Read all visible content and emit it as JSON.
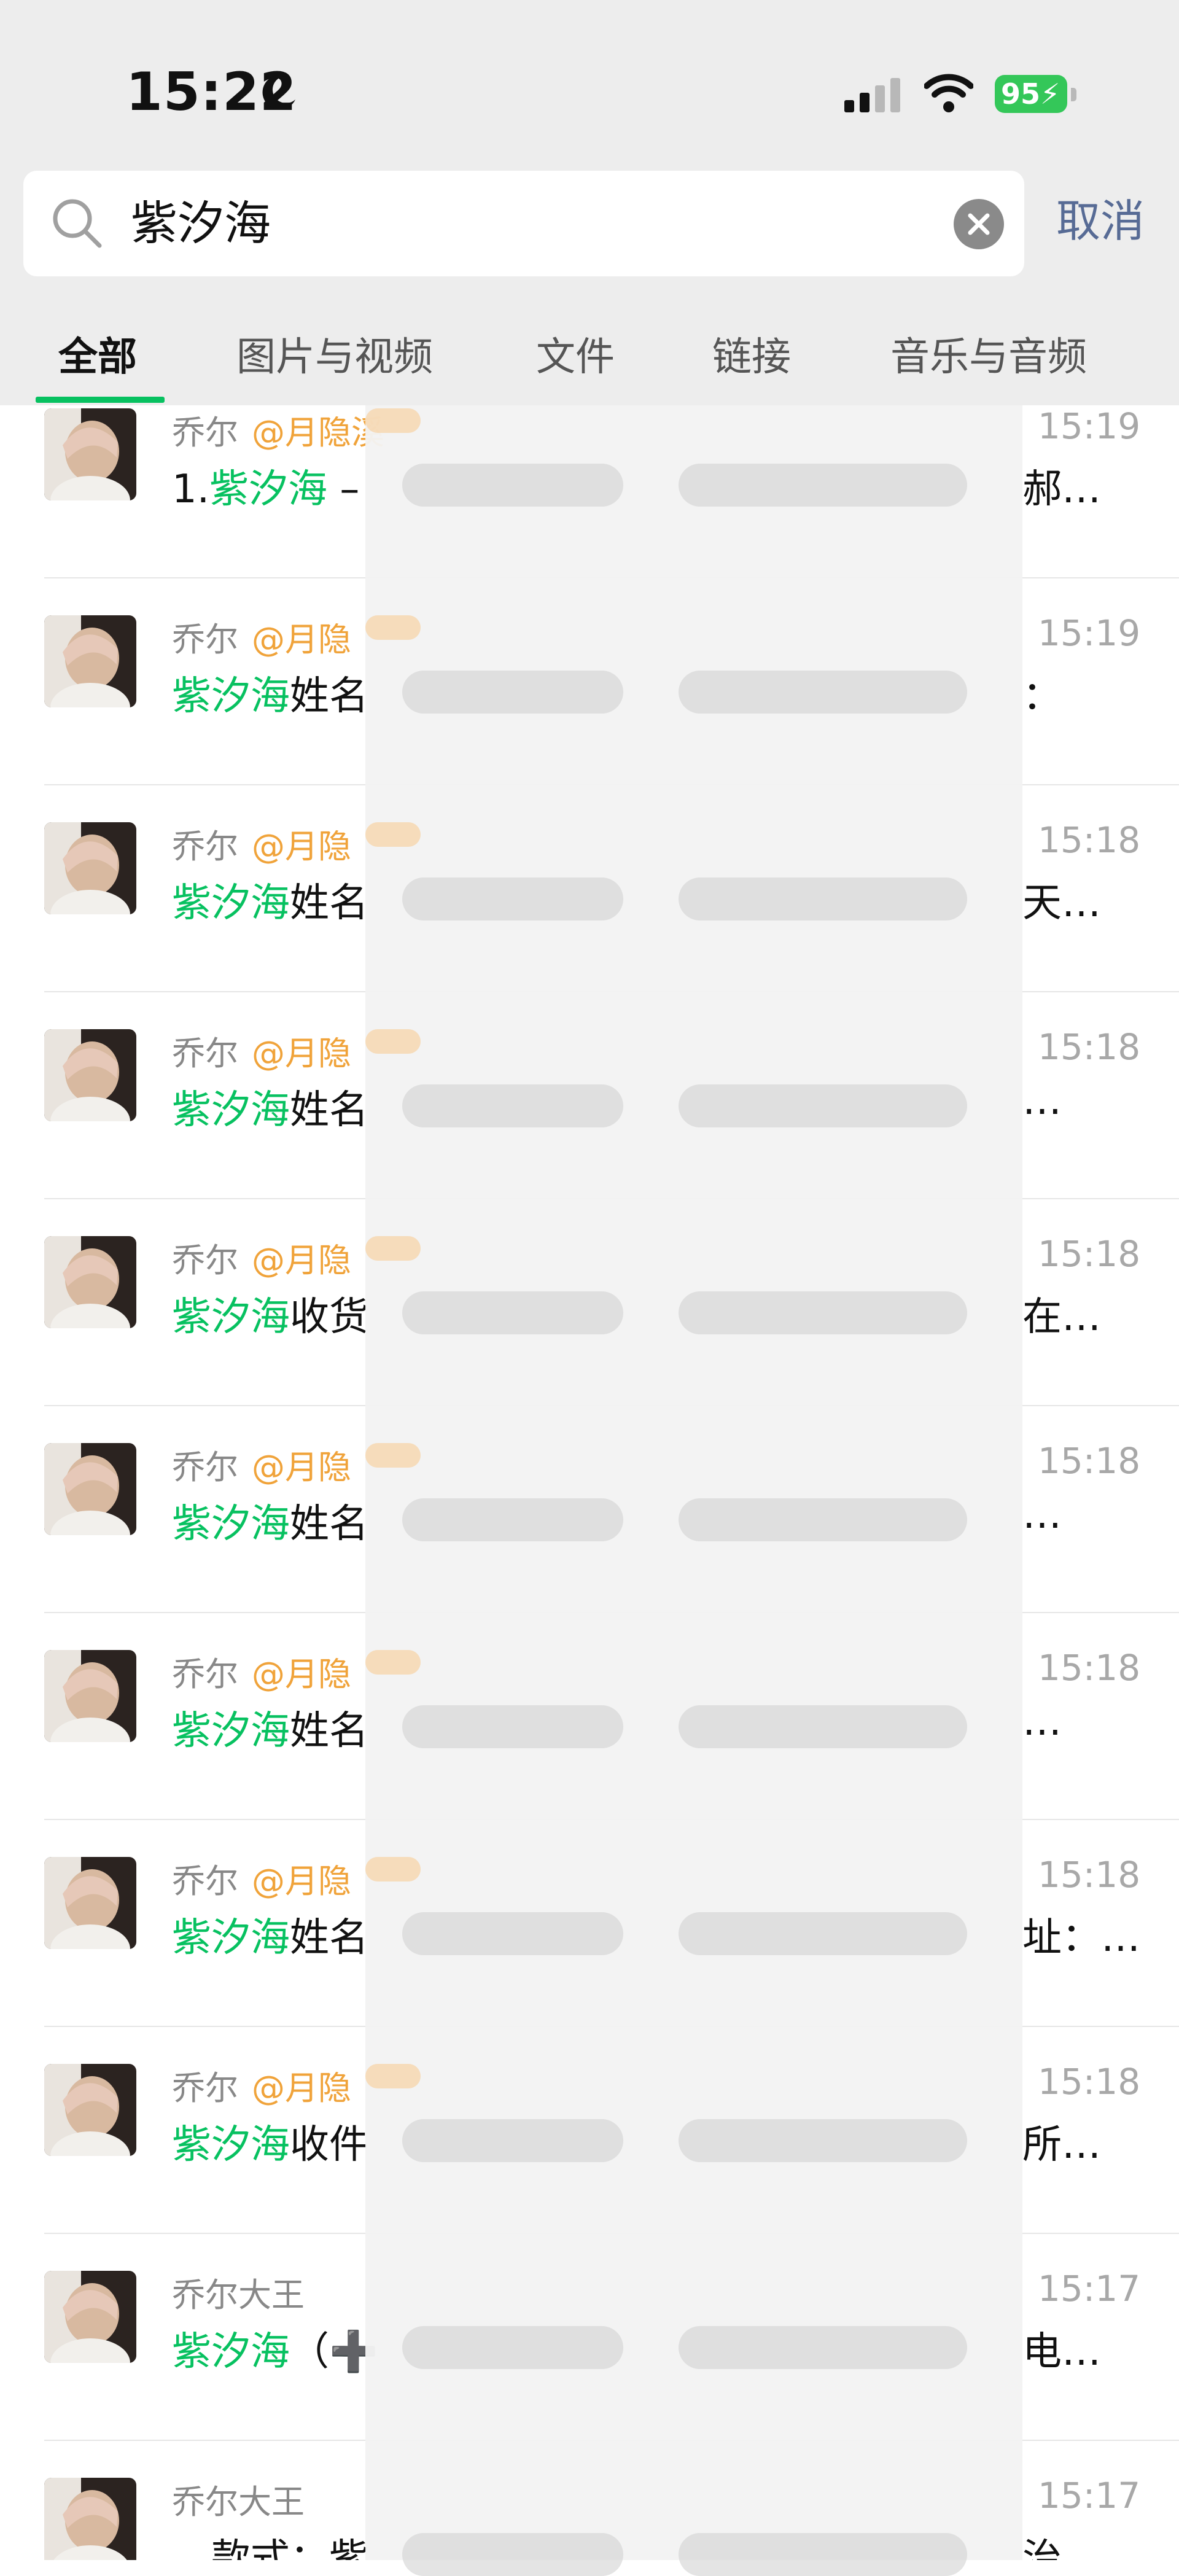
{
  "status_bar": {
    "time": "15:22",
    "battery": "95",
    "icons": [
      "moon-icon",
      "signal-icon",
      "wifi-icon",
      "battery-icon"
    ]
  },
  "search": {
    "value": "紫汐海",
    "cancel_label": "取消"
  },
  "tabs": [
    {
      "label": "全部",
      "active": true
    },
    {
      "label": "图片与视频",
      "active": false
    },
    {
      "label": "文件",
      "active": false
    },
    {
      "label": "链接",
      "active": false
    },
    {
      "label": "音乐与音频",
      "active": false
    }
  ],
  "results": [
    {
      "sender": "乔尔",
      "mention": "@月隐溪",
      "time": "15:19",
      "prefix": "1.",
      "keyword": "紫汐海",
      "rest": " –",
      "tail": "郝…"
    },
    {
      "sender": "乔尔",
      "mention": "@月隐",
      "time": "15:19",
      "prefix": "",
      "keyword": "紫汐海",
      "rest": "姓名",
      "tail": "："
    },
    {
      "sender": "乔尔",
      "mention": "@月隐",
      "time": "15:18",
      "prefix": "",
      "keyword": "紫汐海",
      "rest": "姓名",
      "tail": "天…"
    },
    {
      "sender": "乔尔",
      "mention": "@月隐",
      "time": "15:18",
      "prefix": "",
      "keyword": "紫汐海",
      "rest": "姓名",
      "tail": "…"
    },
    {
      "sender": "乔尔",
      "mention": "@月隐",
      "time": "15:18",
      "prefix": "",
      "keyword": "紫汐海",
      "rest": "收货",
      "tail": "在…"
    },
    {
      "sender": "乔尔",
      "mention": "@月隐",
      "time": "15:18",
      "prefix": "",
      "keyword": "紫汐海",
      "rest": "姓名",
      "tail": "…"
    },
    {
      "sender": "乔尔",
      "mention": "@月隐",
      "time": "15:18",
      "prefix": "",
      "keyword": "紫汐海",
      "rest": "姓名",
      "tail": "…"
    },
    {
      "sender": "乔尔",
      "mention": "@月隐",
      "time": "15:18",
      "prefix": "",
      "keyword": "紫汐海",
      "rest": "姓名",
      "tail": "址：…"
    },
    {
      "sender": "乔尔",
      "mention": "@月隐",
      "time": "15:18",
      "prefix": "",
      "keyword": "紫汐海",
      "rest": "收件",
      "tail": "所…"
    },
    {
      "sender": "乔尔大王",
      "mention": "",
      "time": "15:17",
      "prefix": "",
      "keyword": "紫汐海",
      "rest": "（➕",
      "tail": "电…"
    },
    {
      "sender": "乔尔大王",
      "mention": "",
      "time": "15:17",
      "prefix": "",
      "keyword": "",
      "rest": "…款式：紫",
      "tail": "治"
    }
  ],
  "colors": {
    "highlight": "#07c160",
    "mention": "#f0a33a",
    "cancel": "#576b95",
    "header_bg": "#ededed"
  }
}
